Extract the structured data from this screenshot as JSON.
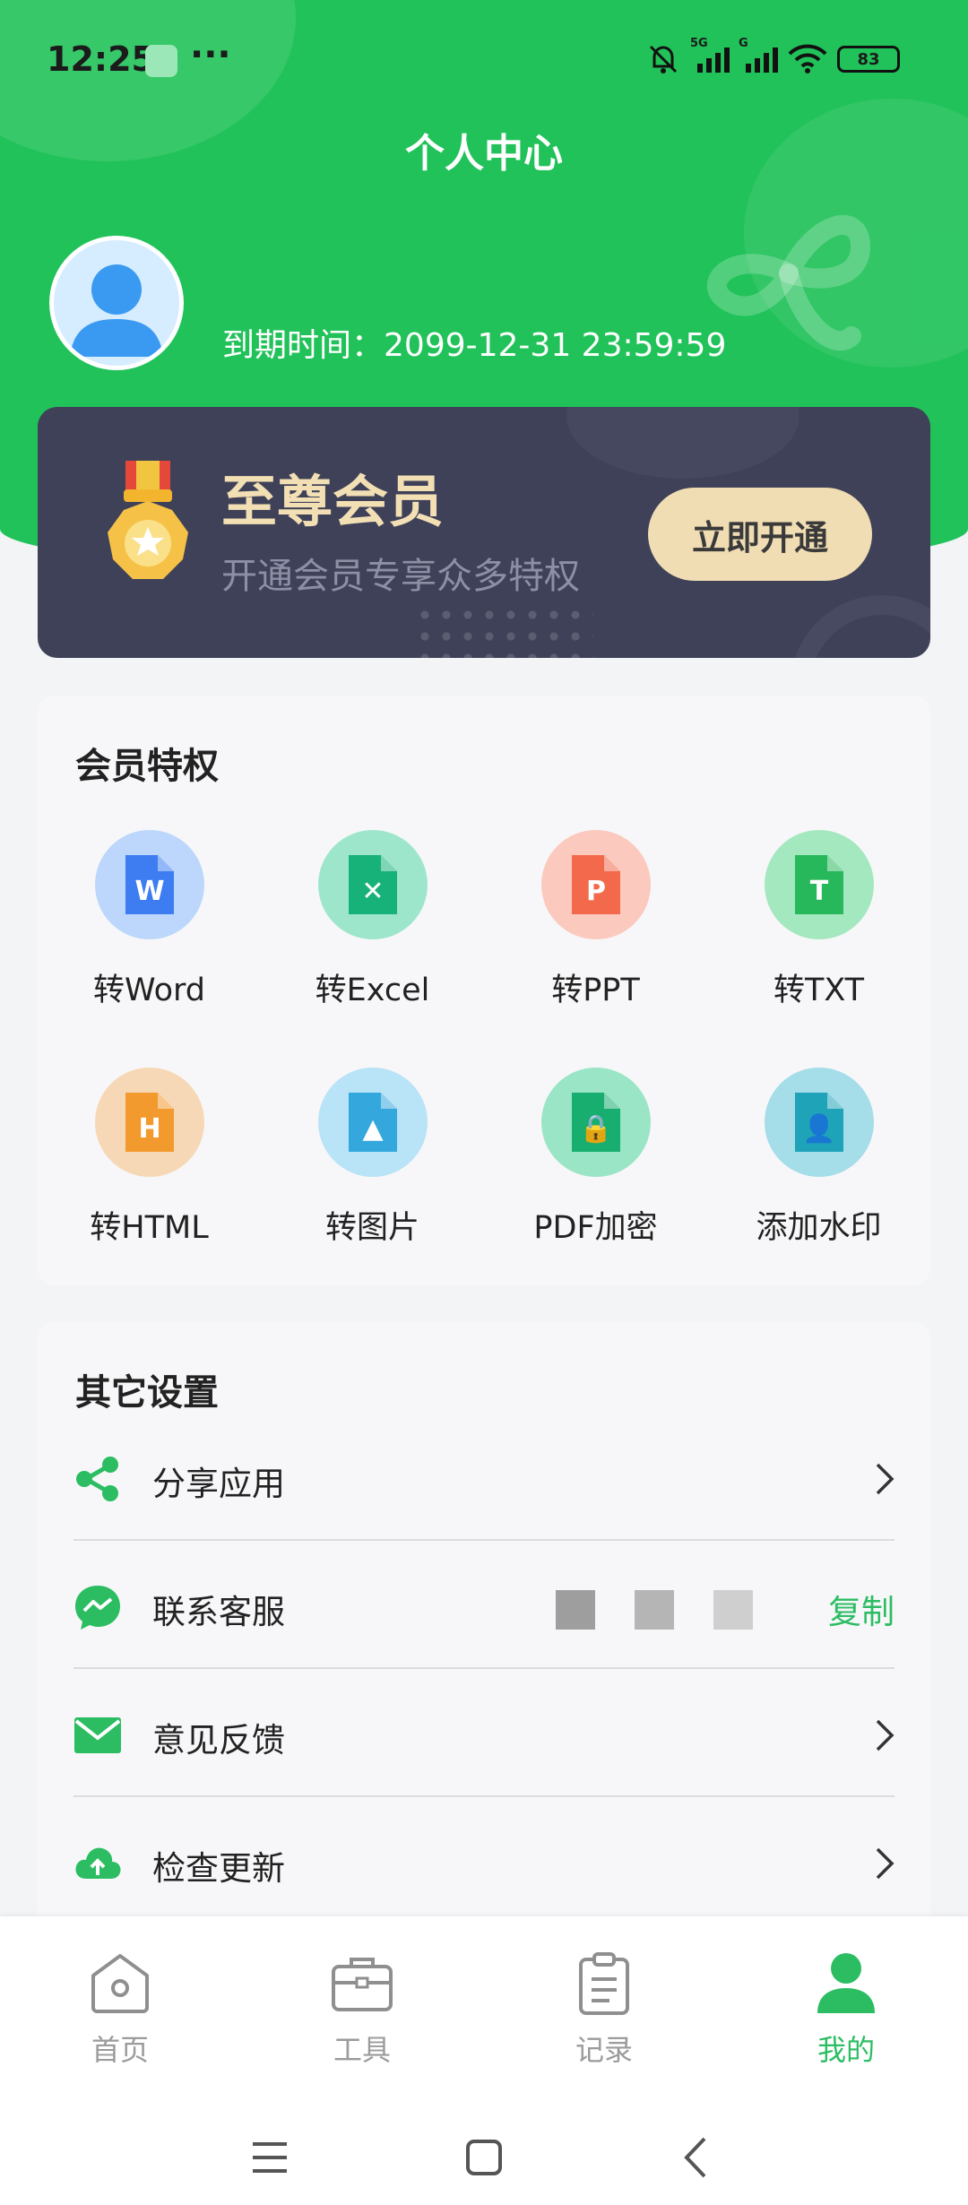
{
  "status_bar": {
    "time": "12:25",
    "more": "···",
    "battery": "83"
  },
  "header": {
    "title": "个人中心"
  },
  "profile": {
    "expiry_label": "到期时间：",
    "expiry_value": "2099-12-31 23:59:59"
  },
  "vip_card": {
    "title": "至尊会员",
    "subtitle": "开通会员专享众多特权",
    "button": "立即开通"
  },
  "privileges": {
    "title": "会员特权",
    "items": [
      {
        "label": "转Word",
        "icon": "word-icon",
        "letter": "W",
        "bg": "#bcd7fb",
        "fg": "#3d7df1"
      },
      {
        "label": "转Excel",
        "icon": "excel-icon",
        "letter": "✕",
        "bg": "#9ee6cb",
        "fg": "#17b27a"
      },
      {
        "label": "转PPT",
        "icon": "ppt-icon",
        "letter": "P",
        "bg": "#fbc9bd",
        "fg": "#f2694b"
      },
      {
        "label": "转TXT",
        "icon": "txt-icon",
        "letter": "T",
        "bg": "#a4e8bf",
        "fg": "#28b85c"
      },
      {
        "label": "转HTML",
        "icon": "html-icon",
        "letter": "H",
        "bg": "#f7d8b6",
        "fg": "#f39a2f"
      },
      {
        "label": "转图片",
        "icon": "image-icon",
        "letter": "▲",
        "bg": "#b9e3f7",
        "fg": "#34a8dc"
      },
      {
        "label": "PDF加密",
        "icon": "lock-icon",
        "letter": "🔒",
        "bg": "#9ae5c6",
        "fg": "#17ae6f"
      },
      {
        "label": "添加水印",
        "icon": "watermark-icon",
        "letter": "👤",
        "bg": "#a5dde9",
        "fg": "#1fa3b8"
      }
    ]
  },
  "settings": {
    "title": "其它设置",
    "items": [
      {
        "label": "分享应用",
        "icon": "share-icon"
      },
      {
        "label": "联系客服",
        "icon": "chat-icon",
        "action": "复制"
      },
      {
        "label": "意见反馈",
        "icon": "mail-icon"
      },
      {
        "label": "检查更新",
        "icon": "cloud-upload-icon"
      }
    ]
  },
  "tabbar": {
    "items": [
      {
        "label": "首页",
        "icon": "home-icon"
      },
      {
        "label": "工具",
        "icon": "toolbox-icon"
      },
      {
        "label": "记录",
        "icon": "clipboard-icon"
      },
      {
        "label": "我的",
        "icon": "user-icon",
        "active": true
      }
    ]
  },
  "colors": {
    "brand": "#21c259",
    "accent": "#2cbd63",
    "vip_bg": "#3e4158",
    "vip_gold": "#f1ddb4"
  }
}
